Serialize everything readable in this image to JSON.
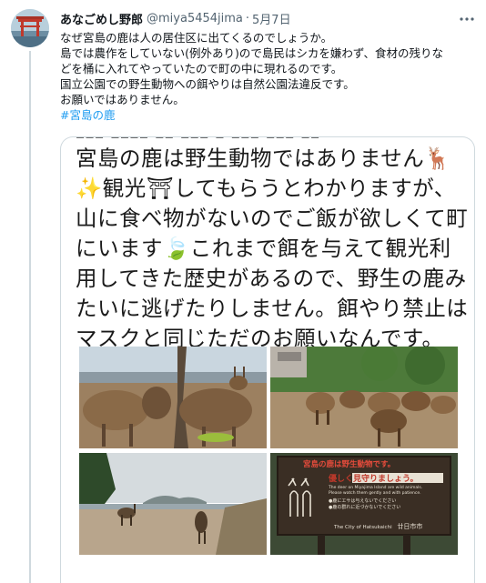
{
  "tweet": {
    "display_name": "あなごめし野郎",
    "handle": "@miya5454jima",
    "separator": "·",
    "date": "5月7日",
    "more_icon": "more-icon",
    "body_lines": [
      "なぜ宮島の鹿は人の居住区に出てくるのでしょうか。",
      "島では農作をしていない(例外あり)ので島民はシカを嫌わず、食材の残りな",
      "どを桶に入れてやっていたので町の中に現れるのです。",
      "国立公園での野生動物への餌やりは自然公園法違反です。",
      "お願いではありません。"
    ],
    "hashtag": "#宮島の鹿"
  },
  "media": {
    "caption_top_fragment": "ｰｰｰ ｰｰｰｰ ｰｰ ｰｰｰ ｰ ｰｰｰ ｰｰｰ ｰｰ",
    "caption_lines": [
      "宮島の鹿は野生動物ではありません🦌",
      "✨観光⛩してもらうとわかりますが、",
      "山に食べ物がないのでご飯が欲しくて町",
      "にいます🍃これまで餌を与えて観光利",
      "用してきた歴史があるので、野生の鹿み",
      "たいに逃げたりしません。餌やり禁止は",
      "マスクと同じただのお願いなんです。"
    ],
    "sign": {
      "title": "宮島の鹿は野生動物です。",
      "subtitle": "優しく見守りましょう。",
      "english_lines": [
        "The deer on Miyajima Island are wild animals.",
        "Please watch them gently and with patience."
      ],
      "japanese_small": [
        "●鹿にエサは与えないでください",
        "●鹿の群れに近づかないでください"
      ],
      "footer_en": "The City of Hatsukaichi",
      "footer_jp": "廿日市市"
    }
  },
  "colors": {
    "link": "#1d9bf0",
    "secondary_text": "#536471",
    "border": "#cfd9de"
  }
}
